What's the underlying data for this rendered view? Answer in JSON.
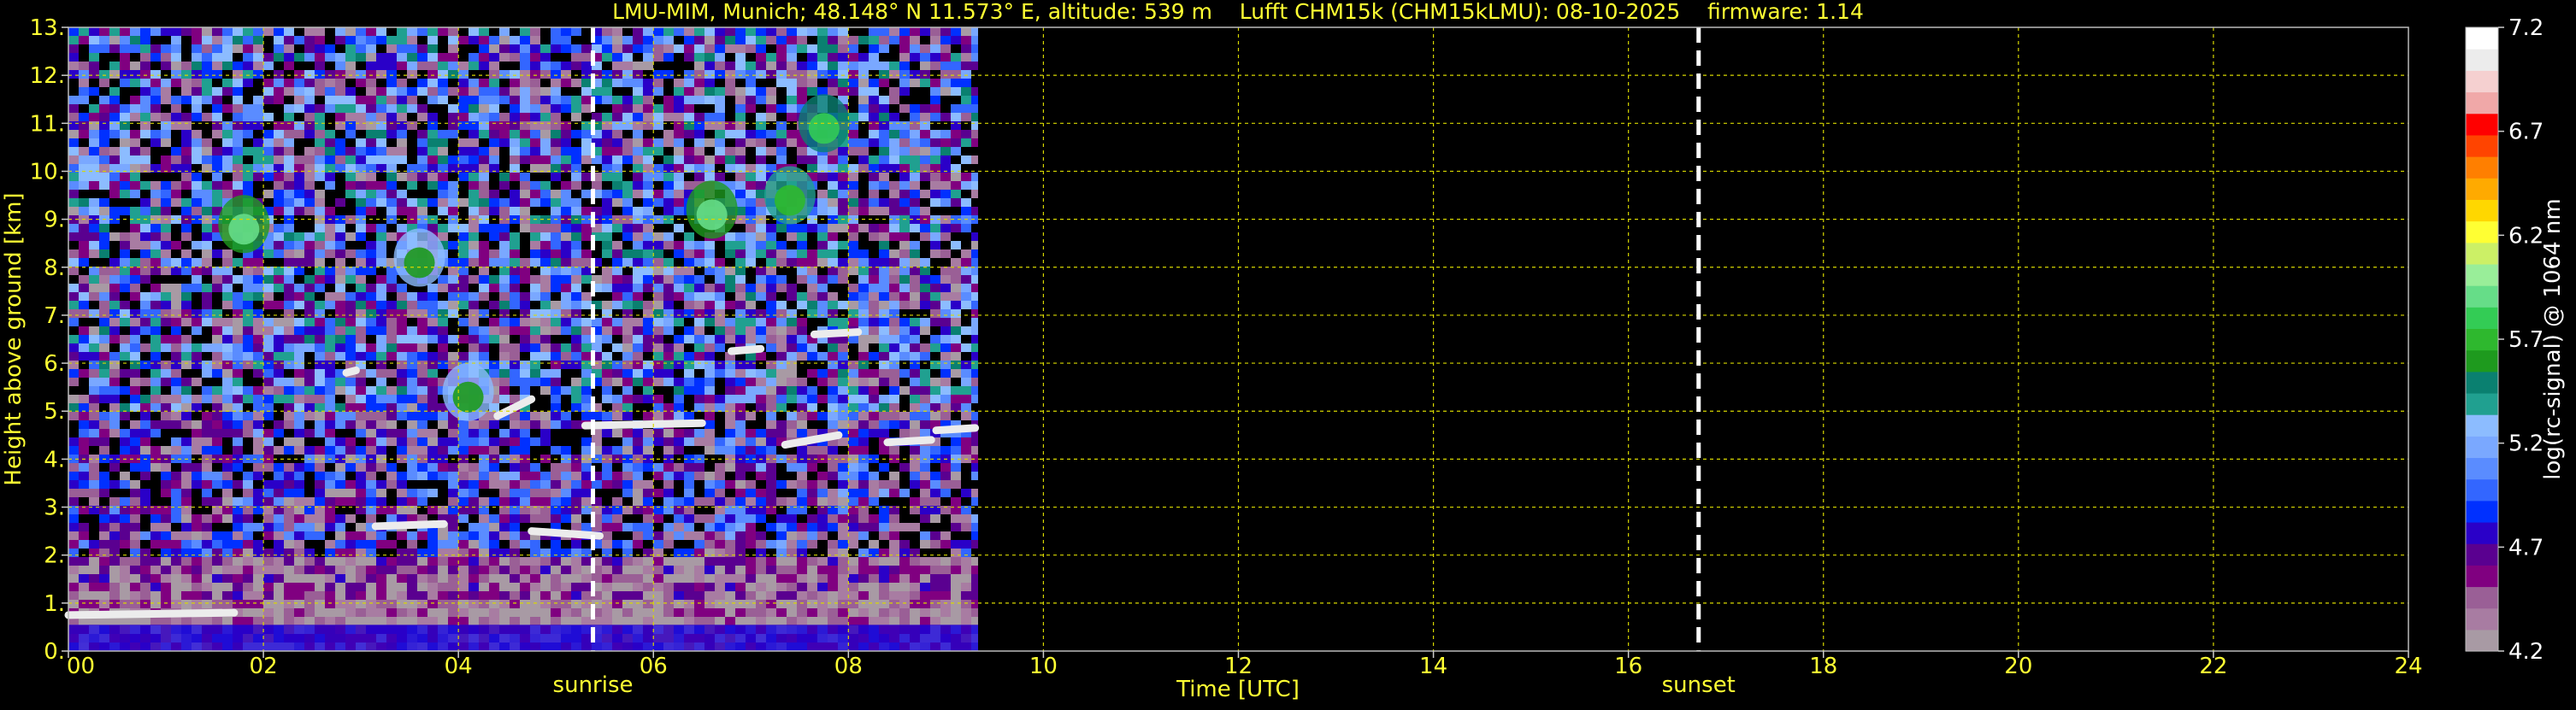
{
  "chart_data": {
    "type": "heatmap",
    "title": "LMU-MIM, Munich; 48.148° N 11.573° E, altitude: 539 m    Lufft CHM15k (CHM15kLMU): 08-10-2025    firmware: 1.14",
    "xlabel": "Time [UTC]",
    "ylabel": "Height above ground [km]",
    "xlim": [
      0,
      24
    ],
    "ylim": [
      0,
      13
    ],
    "x_ticks": [
      {
        "value": 0,
        "label": "00"
      },
      {
        "value": 2,
        "label": "02"
      },
      {
        "value": 4,
        "label": "04"
      },
      {
        "value": 6,
        "label": "06"
      },
      {
        "value": 8,
        "label": "08"
      },
      {
        "value": 10,
        "label": "10"
      },
      {
        "value": 12,
        "label": "12"
      },
      {
        "value": 14,
        "label": "14"
      },
      {
        "value": 16,
        "label": "16"
      },
      {
        "value": 18,
        "label": "18"
      },
      {
        "value": 20,
        "label": "20"
      },
      {
        "value": 22,
        "label": "22"
      },
      {
        "value": 24,
        "label": "24"
      }
    ],
    "y_ticks": [
      {
        "value": 0,
        "label": "0."
      },
      {
        "value": 1,
        "label": "1."
      },
      {
        "value": 2,
        "label": "2."
      },
      {
        "value": 3,
        "label": "3."
      },
      {
        "value": 4,
        "label": "4."
      },
      {
        "value": 5,
        "label": "5."
      },
      {
        "value": 6,
        "label": "6."
      },
      {
        "value": 7,
        "label": "7."
      },
      {
        "value": 8,
        "label": "8."
      },
      {
        "value": 9,
        "label": "9."
      },
      {
        "value": 10,
        "label": "10."
      },
      {
        "value": 11,
        "label": "11."
      },
      {
        "value": 12,
        "label": "12."
      },
      {
        "value": 13,
        "label": "13."
      }
    ],
    "grid": true,
    "data_end_time": 9.33,
    "markers": [
      {
        "time": 5.38,
        "label": "sunrise"
      },
      {
        "time": 16.72,
        "label": "sunset"
      }
    ],
    "colorbar": {
      "label": "log(rc-signal) @ 1064 nm",
      "range": [
        4.2,
        7.2
      ],
      "ticks": [
        {
          "value": 4.2,
          "label": "4.2"
        },
        {
          "value": 4.7,
          "label": "4.7"
        },
        {
          "value": 5.2,
          "label": "5.2"
        },
        {
          "value": 5.7,
          "label": "5.7"
        },
        {
          "value": 6.2,
          "label": "6.2"
        },
        {
          "value": 6.7,
          "label": "6.7"
        },
        {
          "value": 7.2,
          "label": "7.2"
        }
      ],
      "colors": [
        "#a89aa4",
        "#a87ca2",
        "#9a5f96",
        "#800080",
        "#5a0090",
        "#2a00c8",
        "#0030ff",
        "#3366ff",
        "#5a8cff",
        "#7aa8ff",
        "#8cbcff",
        "#20a090",
        "#0a8070",
        "#1e9a1e",
        "#2eb82e",
        "#33cc55",
        "#66dd88",
        "#99ee99",
        "#ccf066",
        "#ffff33",
        "#ffd700",
        "#ffaa00",
        "#ff7f00",
        "#ff4400",
        "#ff0000",
        "#f0a8a8",
        "#f5d0d0",
        "#ececec",
        "#ffffff"
      ]
    },
    "features": [
      {
        "kind": "cloud",
        "t_start": 0.0,
        "t_end": 1.7,
        "h_start": 0.75,
        "h_end": 0.8,
        "level": 7.0
      },
      {
        "kind": "cloud",
        "t_start": 3.15,
        "t_end": 3.85,
        "h_start": 2.6,
        "h_end": 2.65,
        "level": 7.0
      },
      {
        "kind": "cloud",
        "t_start": 4.75,
        "t_end": 5.45,
        "h_start": 2.5,
        "h_end": 2.4,
        "level": 7.0
      },
      {
        "kind": "cloud",
        "t_start": 4.4,
        "t_end": 4.75,
        "h_start": 4.9,
        "h_end": 5.25,
        "level": 7.0
      },
      {
        "kind": "cloud",
        "t_start": 5.3,
        "t_end": 6.5,
        "h_start": 4.7,
        "h_end": 4.75,
        "level": 7.0
      },
      {
        "kind": "cloud",
        "t_start": 7.35,
        "t_end": 7.9,
        "h_start": 4.3,
        "h_end": 4.5,
        "level": 7.0
      },
      {
        "kind": "cloud",
        "t_start": 8.4,
        "t_end": 8.85,
        "h_start": 4.35,
        "h_end": 4.4,
        "level": 7.0
      },
      {
        "kind": "cloud",
        "t_start": 8.9,
        "t_end": 9.3,
        "h_start": 4.6,
        "h_end": 4.65,
        "level": 7.0
      },
      {
        "kind": "cloud",
        "t_start": 6.8,
        "t_end": 7.1,
        "h_start": 6.25,
        "h_end": 6.3,
        "level": 7.0
      },
      {
        "kind": "cloud",
        "t_start": 7.65,
        "t_end": 8.1,
        "h_start": 6.6,
        "h_end": 6.65,
        "level": 7.0
      },
      {
        "kind": "cloud",
        "t_start": 2.85,
        "t_end": 2.95,
        "h_start": 5.8,
        "h_end": 5.85,
        "level": 7.0
      },
      {
        "kind": "aerosol",
        "t": 1.8,
        "h": 8.9,
        "level": 5.9
      },
      {
        "kind": "aerosol",
        "t": 6.6,
        "h": 9.2,
        "level": 5.9
      },
      {
        "kind": "aerosol",
        "t": 7.75,
        "h": 11.0,
        "level": 5.8
      },
      {
        "kind": "aerosol",
        "t": 3.6,
        "h": 8.2,
        "level": 5.6
      },
      {
        "kind": "aerosol",
        "t": 4.1,
        "h": 5.4,
        "level": 5.6
      },
      {
        "kind": "aerosol",
        "t": 7.4,
        "h": 9.5,
        "level": 5.7
      }
    ]
  }
}
